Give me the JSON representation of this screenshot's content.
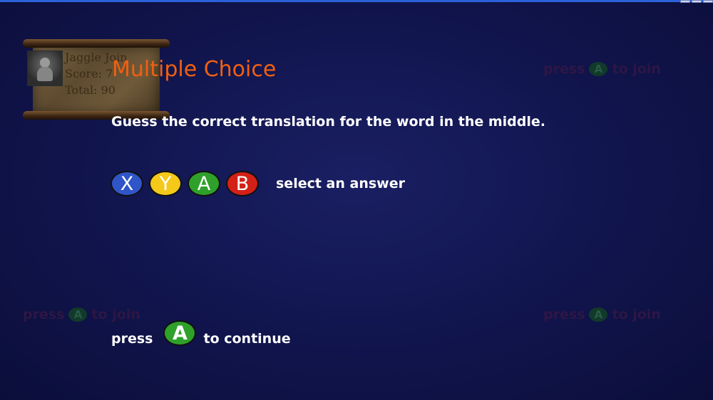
{
  "player": {
    "name": "Jaggle Join",
    "score_line": "Score: 7",
    "total_line": "Total: 90"
  },
  "screen": {
    "title": "Multiple Choice",
    "instruction": "Guess the correct translation for the word in the middle.",
    "answer_buttons": [
      "X",
      "Y",
      "A",
      "B"
    ],
    "select_text": "select an answer",
    "continue_prefix": "press",
    "continue_button": "A",
    "continue_suffix": "to continue"
  },
  "join_prompt": {
    "prefix": "press",
    "button": "A",
    "suffix": "to join"
  },
  "colors": {
    "title": "#f06010",
    "x": "#2f55c9",
    "y": "#f4c91a",
    "a": "#2fa12a",
    "b": "#d32118"
  }
}
